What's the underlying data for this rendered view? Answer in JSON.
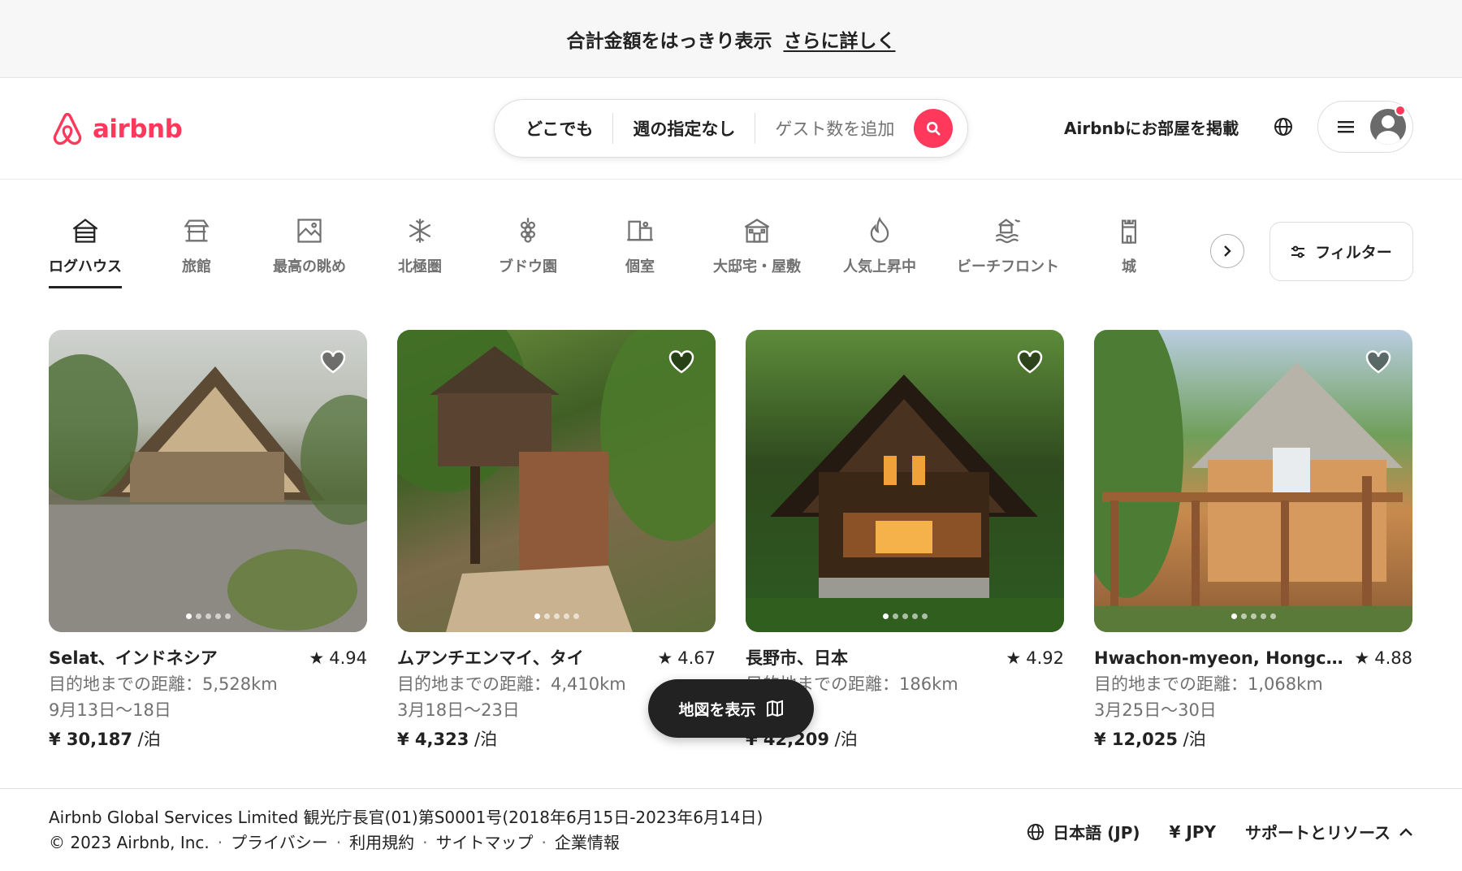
{
  "banner": {
    "text": "合計金額をはっきり表示",
    "link": "さらに詳しく"
  },
  "header": {
    "logo_text": "airbnb",
    "search": {
      "where": "どこでも",
      "when": "週の指定なし",
      "guests": "ゲスト数を追加"
    },
    "host_link": "Airbnbにお部屋を掲載"
  },
  "categories": [
    {
      "label": "ログハウス",
      "icon": "log-cabin-icon",
      "active": true
    },
    {
      "label": "旅館",
      "icon": "ryokan-icon"
    },
    {
      "label": "最高の眺め",
      "icon": "amazing-views-icon"
    },
    {
      "label": "北極圏",
      "icon": "arctic-icon"
    },
    {
      "label": "ブドウ園",
      "icon": "vineyard-icon"
    },
    {
      "label": "個室",
      "icon": "private-room-icon"
    },
    {
      "label": "大邸宅・屋敷",
      "icon": "mansion-icon"
    },
    {
      "label": "人気上昇中",
      "icon": "trending-icon"
    },
    {
      "label": "ビーチフロント",
      "icon": "beachfront-icon"
    },
    {
      "label": "城",
      "icon": "castle-icon"
    }
  ],
  "filter_label": "フィルター",
  "listings": [
    {
      "location": "Selat、インドネシア",
      "rating": "4.94",
      "distance": "目的地までの距離：5,528km",
      "dates": "9月13日～18日",
      "price": "¥ 30,187",
      "per": " /泊"
    },
    {
      "location": "ムアンチエンマイ、タイ",
      "rating": "4.67",
      "distance": "目的地までの距離：4,410km",
      "dates": "3月18日～23日",
      "price": "¥ 4,323",
      "per": " /泊"
    },
    {
      "location": "長野市、日本",
      "rating": "4.92",
      "distance": "目的地までの距離：186km",
      "dates": "～16日",
      "price": "¥ 42,209",
      "per": " /泊"
    },
    {
      "location": "Hwachon-myeon, Hongch...",
      "rating": "4.88",
      "distance": "目的地までの距離：1,068km",
      "dates": "3月25日～30日",
      "price": "¥ 12,025",
      "per": " /泊"
    }
  ],
  "map_button": "地図を表示",
  "footer": {
    "company": "Airbnb Global Services Limited 観光庁長官(01)第S0001号(2018年6月15日-2023年6月14日)",
    "copyright": "© 2023 Airbnb, Inc.",
    "links": [
      "プライバシー",
      "利用規約",
      "サイトマップ",
      "企業情報"
    ],
    "separator": "·",
    "language": "日本語 (JP)",
    "currency": "¥  JPY",
    "support": "サポートとリソース"
  },
  "colors": {
    "brand": "#ff385c",
    "text": "#222222",
    "muted": "#717171"
  }
}
